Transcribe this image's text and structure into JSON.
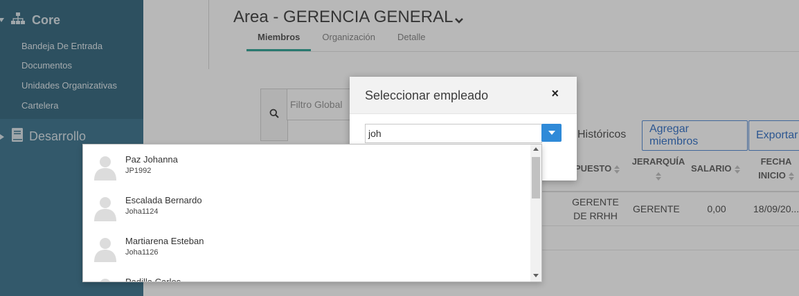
{
  "sidebar": {
    "core_title": "Core",
    "items": [
      {
        "label": "Bandeja De Entrada"
      },
      {
        "label": "Documentos"
      },
      {
        "label": "Unidades Organizativas"
      },
      {
        "label": "Cartelera"
      }
    ],
    "dev_title": "Desarrollo"
  },
  "page": {
    "title": "Area - GERENCIA GENERAL",
    "tabs": [
      {
        "label": "Miembros"
      },
      {
        "label": "Organización"
      },
      {
        "label": "Detalle"
      }
    ],
    "filter_placeholder": "Filtro Global",
    "historicos": "Históricos",
    "add_members": "Agregar miembros",
    "export": "Exportar",
    "table": {
      "headers": {
        "puesto": "PUESTO",
        "jerarquia": "JERARQUÍA",
        "salario": "SALARIO",
        "fecha_inicio_1": "FECHA",
        "fecha_inicio_2": "INICIO"
      },
      "row": {
        "puesto_1": "GERENTE",
        "puesto_2": "DE RRHH",
        "jerarquia": "GERENTE",
        "salario": "0,00",
        "fecha_inicio": "18/09/20..."
      }
    }
  },
  "modal": {
    "title": "Seleccionar empleado",
    "close": "×",
    "search_value": "joh"
  },
  "dropdown": {
    "options": [
      {
        "name": "Paz Johanna",
        "code": "JP1992"
      },
      {
        "name": "Escalada Bernardo",
        "code": "Joha1124"
      },
      {
        "name": "Martiarena Esteban",
        "code": "Joha1126"
      },
      {
        "name": "Padilla Carlos",
        "code": ""
      }
    ]
  },
  "colors": {
    "sidebar": "#477c95",
    "accent_tab": "#3aa89a",
    "primary_button": "#2f8ad8",
    "outline_button": "#5b8fd6"
  },
  "icons": {
    "core": "sitemap-icon",
    "dev": "book-icon",
    "search": "search-icon",
    "close": "close-icon",
    "combo": "caret-down-icon",
    "avatar": "user-avatar-icon"
  }
}
